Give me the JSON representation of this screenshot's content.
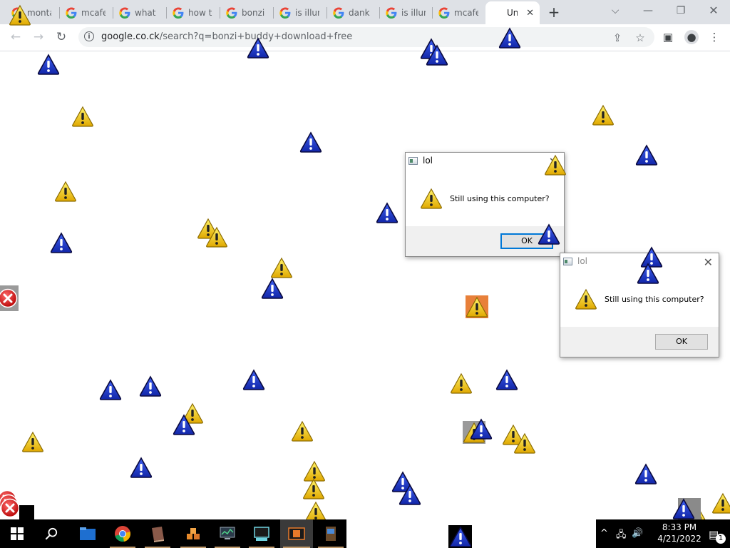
{
  "browser": {
    "tabs": [
      {
        "label": "monta"
      },
      {
        "label": "mcafe"
      },
      {
        "label": "what h"
      },
      {
        "label": "how to"
      },
      {
        "label": "bonzi b"
      },
      {
        "label": "is illun"
      },
      {
        "label": "dank m"
      },
      {
        "label": "is illun"
      },
      {
        "label": "mcafe"
      },
      {
        "label": "Un"
      }
    ],
    "active_tab_close": "✕",
    "new_tab": "+",
    "url_host": "google.co.ck",
    "url_path": "/search?q=bonzi+buddy+download+free",
    "info_glyph": "i"
  },
  "dialogs": [
    {
      "title": "lol",
      "message": "Still using this computer?",
      "ok": "OK",
      "close": "✕"
    },
    {
      "title": "lol",
      "message": "Still using this computer?",
      "ok": "OK",
      "close": "✕"
    }
  ],
  "taskbar": {
    "time": "8:33 PM",
    "date": "4/21/2022",
    "notification_count": "1",
    "accent": "#0078d7"
  },
  "icons": {
    "warning": "warning-icon",
    "info_triangle": "blue-warning-icon",
    "error": "error-icon"
  }
}
